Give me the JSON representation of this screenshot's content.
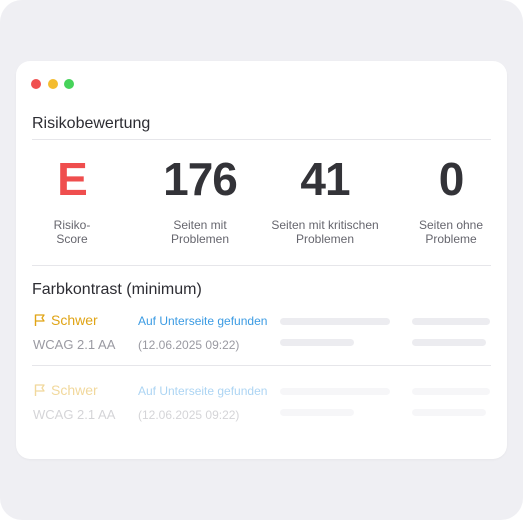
{
  "risk": {
    "title": "Risikobewertung",
    "stats": [
      {
        "value": "E",
        "label_1": "Risiko-",
        "label_2": "Score"
      },
      {
        "value": "176",
        "label_1": "Seiten mit",
        "label_2": "Problemen"
      },
      {
        "value": "41",
        "label_1": "Seiten mit kritischen",
        "label_2": "Problemen"
      },
      {
        "value": "0",
        "label_1": "Seiten ohne",
        "label_2": "Probleme"
      }
    ]
  },
  "contrast": {
    "title": "Farbkontrast (minimum)",
    "rows": [
      {
        "severity": "Schwer",
        "standard": "WCAG 2.1 AA",
        "link": "Auf Unterseite gefunden",
        "date": "(12.06.2025 09:22)"
      },
      {
        "severity": "Schwer",
        "standard": "WCAG 2.1 AA",
        "link": "Auf Unterseite gefunden",
        "date": "(12.06.2025 09:22)"
      }
    ]
  },
  "colors": {
    "score": "#ef4e4e",
    "severity": "#e0a415",
    "link": "#3b9be3"
  },
  "icons": {
    "severity": "flag-icon"
  }
}
